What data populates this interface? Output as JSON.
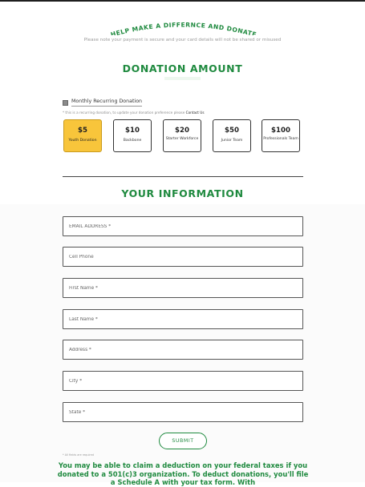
{
  "header": {
    "banner_title": "HELP MAKE A DIFFERNCE AND DONATE",
    "security_note": "Please note your payment is secure and your card details will not be shared or misused"
  },
  "donation": {
    "heading": "DONATION AMOUNT",
    "recurring_label": "Monthly Recurring Donation",
    "recurring_checked": true,
    "note_text": "* this is a recurring donation, to update your donation preference please",
    "note_link": "Contact Us",
    "amounts": [
      {
        "value": "$5",
        "label": "Youth Donation",
        "selected": true
      },
      {
        "value": "$10",
        "label": "Backbone",
        "selected": false
      },
      {
        "value": "$20",
        "label": "Starter Workforce",
        "selected": false
      },
      {
        "value": "$50",
        "label": "Junior Team",
        "selected": false
      },
      {
        "value": "$100",
        "label": "Professionals Team",
        "selected": false
      }
    ]
  },
  "info": {
    "heading": "YOUR INFORMATION",
    "fields": [
      {
        "placeholder": "EMAIL ADDRESS *",
        "value": ""
      },
      {
        "placeholder": "Cell Phone",
        "value": ""
      },
      {
        "placeholder": "First Name *",
        "value": ""
      },
      {
        "placeholder": "Last Name *",
        "value": ""
      },
      {
        "placeholder": "Address *",
        "value": ""
      },
      {
        "placeholder": "City *",
        "value": ""
      },
      {
        "placeholder": "State *",
        "value": ""
      }
    ],
    "required_note": "* All fields are required",
    "submit_label": "SUBMIT"
  },
  "footer": {
    "tax_note": "You may be able to claim a deduction on your federal taxes if you donated to a 501(c)3 organization. To deduct donations, you'll file a Schedule A with your tax form. With"
  },
  "colors": {
    "brand_green": "#1f8a3f",
    "selected_yellow": "#f8c53b"
  }
}
